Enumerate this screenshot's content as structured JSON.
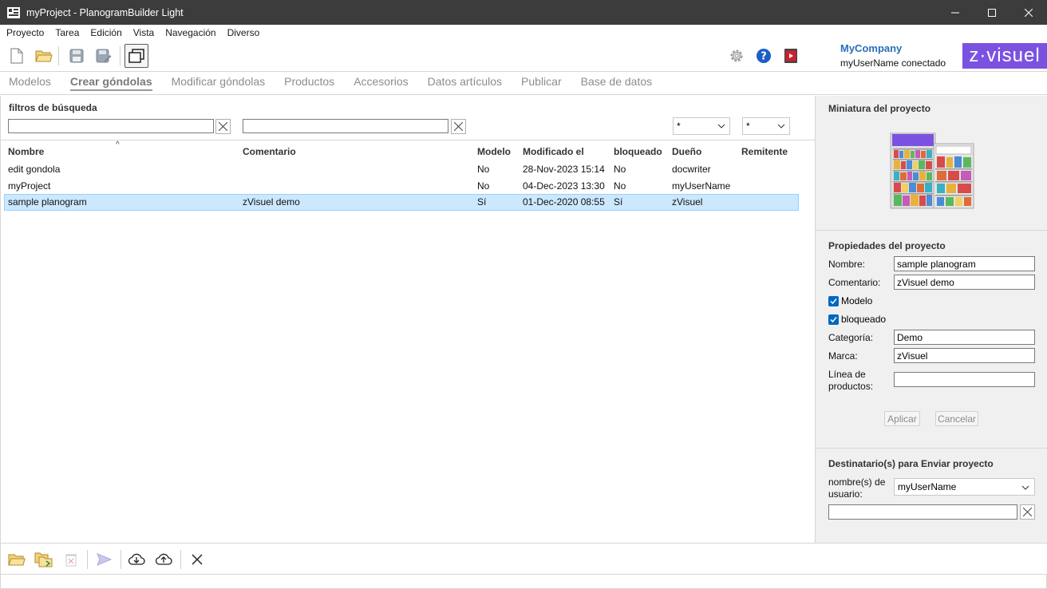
{
  "window": {
    "title": "myProject - PlanogramBuilder Light"
  },
  "menu": [
    "Proyecto",
    "Tarea",
    "Edición",
    "Vista",
    "Navegación",
    "Diverso"
  ],
  "header": {
    "company": "MyCompany",
    "user_status": "myUserName conectado",
    "logo_text": "zvisuel"
  },
  "tabs": [
    {
      "label": "Modelos"
    },
    {
      "label": "Crear góndolas",
      "active": true
    },
    {
      "label": "Modificar góndolas"
    },
    {
      "label": "Productos"
    },
    {
      "label": "Accesorios"
    },
    {
      "label": "Datos artículos"
    },
    {
      "label": "Publicar"
    },
    {
      "label": "Base de datos"
    }
  ],
  "filters": {
    "title": "filtros de búsqueda",
    "name_filter": "",
    "comment_filter": "",
    "modelo_filter": "*",
    "bloqueado_filter": "*"
  },
  "table": {
    "columns": [
      "Nombre",
      "Comentario",
      "Modelo",
      "Modificado el",
      "bloqueado",
      "Dueño",
      "Remitente"
    ],
    "rows": [
      {
        "nombre": "edit gondola",
        "comentario": "",
        "modelo": "No",
        "modificado": "28-Nov-2023 15:14",
        "bloqueado": "No",
        "dueno": "docwriter",
        "remitente": ""
      },
      {
        "nombre": "myProject",
        "comentario": "",
        "modelo": "No",
        "modificado": "04-Dec-2023 13:30",
        "bloqueado": "No",
        "dueno": "myUserName",
        "remitente": ""
      },
      {
        "nombre": "sample planogram",
        "comentario": "zVisuel demo",
        "modelo": "Sí",
        "modificado": "01-Dec-2020 08:55",
        "bloqueado": "Sí",
        "dueno": "zVisuel",
        "remitente": "",
        "selected": true
      }
    ]
  },
  "thumbnail": {
    "title": "Miniatura del proyecto"
  },
  "properties": {
    "title": "Propiedades del proyecto",
    "nombre_label": "Nombre:",
    "nombre_value": "sample planogram",
    "comentario_label": "Comentario:",
    "comentario_value": "zVisuel demo",
    "modelo_label": "Modelo",
    "modelo_checked": true,
    "bloqueado_label": "bloqueado",
    "bloqueado_checked": true,
    "categoria_label": "Categoría:",
    "categoria_value": "Demo",
    "marca_label": "Marca:",
    "marca_value": "zVisuel",
    "linea_label_1": "Línea de",
    "linea_label_2": "productos:",
    "linea_value": "",
    "apply_label": "Aplicar",
    "cancel_label": "Cancelar"
  },
  "recipients": {
    "title": "Destinatario(s) para Enviar proyecto",
    "users_label_1": "nombre(s) de",
    "users_label_2": "usuario:",
    "users_value": "myUserName",
    "extra_value": ""
  },
  "colors": {
    "accent": "#0067c0",
    "selection": "#cce8ff",
    "brand": "#7b52e0",
    "company": "#2a6ebb"
  }
}
